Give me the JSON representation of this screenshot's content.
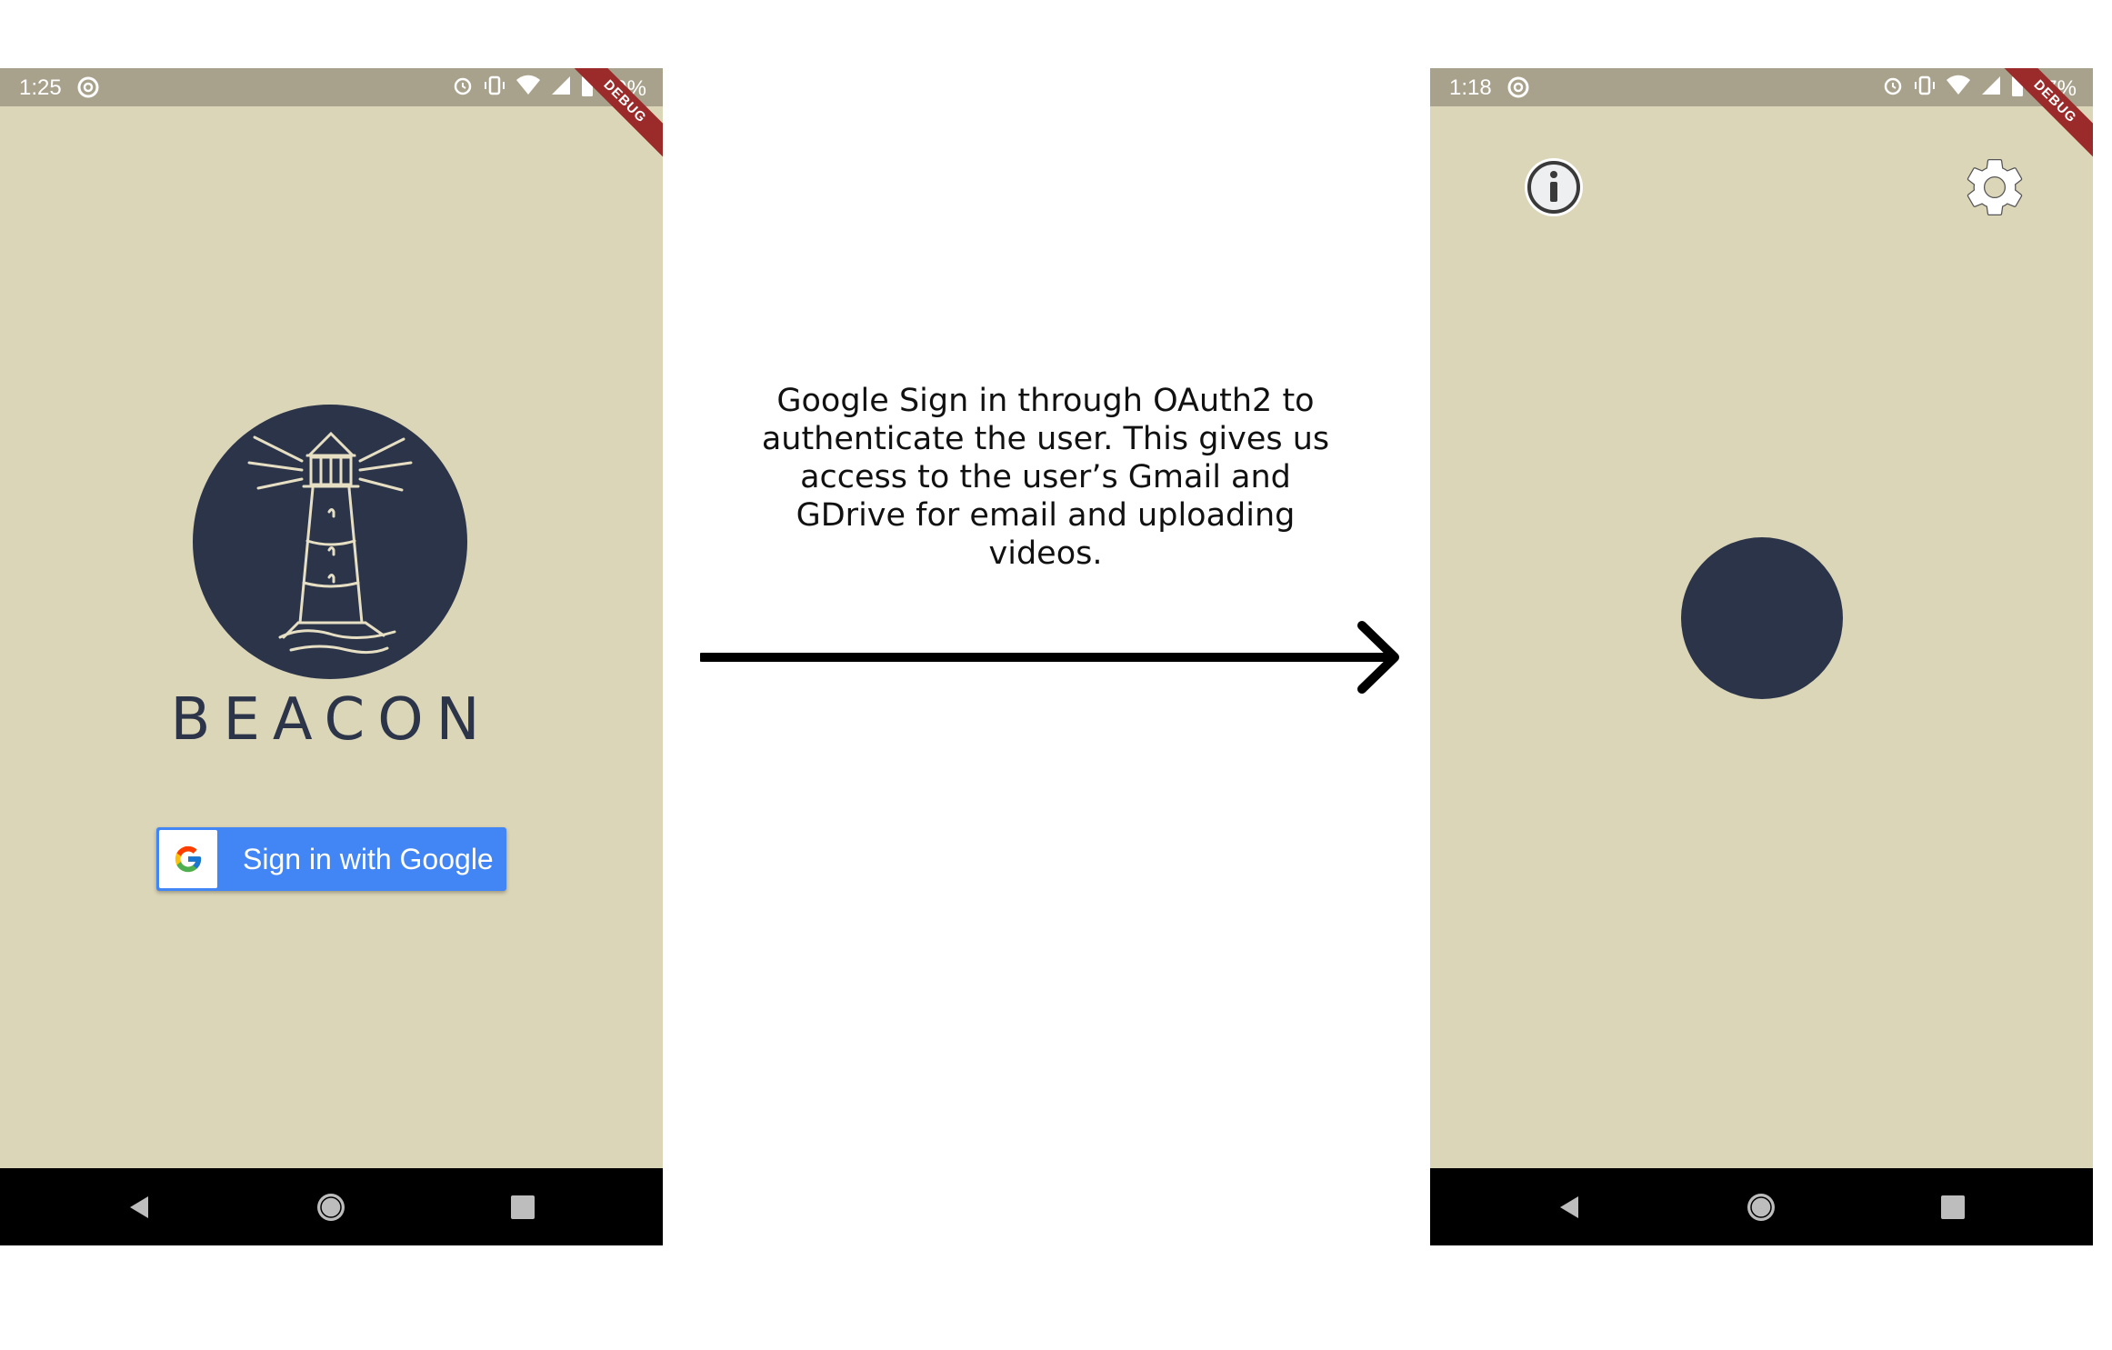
{
  "left_screen": {
    "status_bar": {
      "time": "1:25",
      "battery": "99%",
      "debug_banner": "DEBUG"
    },
    "app_title": "BEACON",
    "signin_button": {
      "label": "Sign in with Google",
      "icon": "google-g-icon"
    },
    "nav": {
      "back": "back-icon",
      "home": "home-icon",
      "recents": "recents-icon"
    }
  },
  "caption": "Google Sign in through OAuth2 to authenticate the user. This gives us access to the user’s Gmail and GDrive for email and uploading videos.",
  "right_screen": {
    "status_bar": {
      "time": "1:18",
      "battery": "97%",
      "debug_banner": "DEBUG"
    },
    "toolbar": {
      "info_icon": "info-icon",
      "settings_icon": "gear-icon"
    },
    "nav": {
      "back": "back-icon",
      "home": "home-icon",
      "recents": "recents-icon"
    }
  },
  "colors": {
    "app_background": "#dcd6b8",
    "status_bar": "#a8a18b",
    "navy": "#2b3448",
    "google_blue": "#4285f4",
    "debug_ribbon": "#9b2a2a"
  }
}
